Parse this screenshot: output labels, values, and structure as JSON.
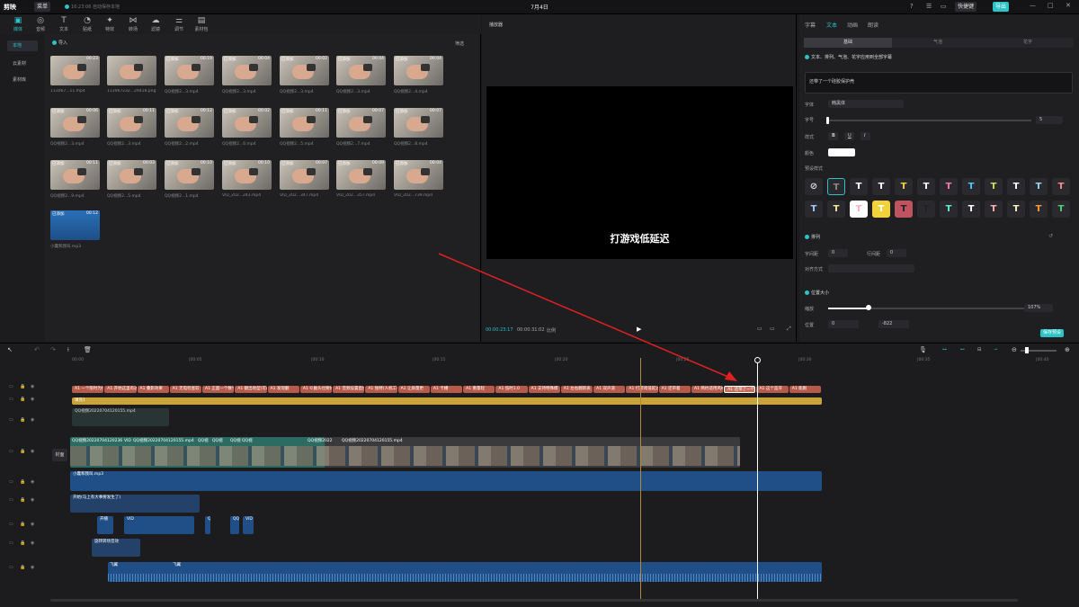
{
  "app": {
    "logo": "剪映",
    "menu": "菜单",
    "save_status": "16:23:06 自动保存本地",
    "title": "7月4日",
    "shortcut": "快捷键",
    "export": "导出"
  },
  "tools": [
    {
      "label": "媒体"
    },
    {
      "label": "音频"
    },
    {
      "label": "文本"
    },
    {
      "label": "贴纸"
    },
    {
      "label": "特效"
    },
    {
      "label": "转场"
    },
    {
      "label": "滤镜"
    },
    {
      "label": "调节"
    },
    {
      "label": "素材包"
    }
  ],
  "side": {
    "items": [
      "本地",
      "云素材",
      "素材库"
    ]
  },
  "media": {
    "import": "导入",
    "sort": "筛选",
    "items": [
      {
        "name": "113067...11.mp4",
        "dur": "00:23",
        "added": ""
      },
      {
        "name": "113067232...29418.png",
        "dur": "",
        "added": ""
      },
      {
        "name": "QQ视频2...3.mp4",
        "dur": "00:19",
        "added": "已添加"
      },
      {
        "name": "QQ视频2...3.mp4",
        "dur": "00:04",
        "added": "已添加"
      },
      {
        "name": "QQ视频2...3.mp4",
        "dur": "00:02",
        "added": "已添加"
      },
      {
        "name": "QQ视频2...3.mp4",
        "dur": "00:04",
        "added": "已添加"
      },
      {
        "name": "QQ视频2...4.mp4",
        "dur": "00:04",
        "added": "已添加"
      },
      {
        "name": "QQ视频2...3.mp4",
        "dur": "00:06",
        "added": "已添加"
      },
      {
        "name": "QQ视频2...3.mp4",
        "dur": "00:11",
        "added": "已添加"
      },
      {
        "name": "QQ视频2...2.mp4",
        "dur": "00:12",
        "added": "已添加"
      },
      {
        "name": "QQ视频2...6.mp4",
        "dur": "00:02",
        "added": "已添加"
      },
      {
        "name": "QQ视频2...5.mp4",
        "dur": "00:11",
        "added": "已添加"
      },
      {
        "name": "QQ视频2...7.mp4",
        "dur": "00:07",
        "added": "已添加"
      },
      {
        "name": "QQ视频2...8.mp4",
        "dur": "00:07",
        "added": "已添加"
      },
      {
        "name": "QQ视频2...9.mp4",
        "dur": "00:11",
        "added": "已添加"
      },
      {
        "name": "QQ视频2...5.mp4",
        "dur": "00:03",
        "added": "已添加"
      },
      {
        "name": "QQ视频2...1.mp4",
        "dur": "00:10",
        "added": "已添加"
      },
      {
        "name": "VID_202...243.mp4",
        "dur": "00:10",
        "added": "已添加"
      },
      {
        "name": "VID_202...347.mp4",
        "dur": "00:07",
        "added": "已添加"
      },
      {
        "name": "VID_202...357.mp4",
        "dur": "00:09",
        "added": "已添加"
      },
      {
        "name": "VID_202...739.mp4",
        "dur": "00:04",
        "added": "已添加"
      },
      {
        "name": "小蠢和我叫.mp3",
        "dur": "00:12",
        "added": "已添加"
      }
    ]
  },
  "player": {
    "title": "播放器",
    "caption": "打游戏低延迟",
    "time_current": "00:00:23:17",
    "time_total": "00:00:31:02",
    "ratio": "比例"
  },
  "props": {
    "tabs": [
      "字幕",
      "文本",
      "动画",
      "朗读"
    ],
    "segments": [
      "基础",
      "气泡",
      "花字"
    ],
    "apply_all": "文本、排列、气泡、花字应用到全部字幕",
    "text_value": "还带了一个硅胶保护壳",
    "font_label": "字体",
    "font_value": "韩黑体",
    "size_label": "字号",
    "size_value": "5",
    "style_label": "样式",
    "color_label": "颜色",
    "preset_label": "预设样式",
    "arrange_label": "排列",
    "char_spacing": "字间距",
    "char_spacing_val": "0",
    "line_spacing": "行间距",
    "line_spacing_val": "0",
    "align_label": "对齐方式",
    "pos_label": "位置大小",
    "scale_label": "缩放",
    "scale_value": "107%",
    "position_label": "位置",
    "x_val": "0",
    "y_val": "-822",
    "save_preset": "保存预设"
  },
  "timeline": {
    "ruler": [
      "00:00",
      "|00:05",
      "|00:10",
      "|00:15",
      "|00:20",
      "|00:25",
      "|00:30",
      "|00:35",
      "|00:40"
    ],
    "cover": "封面",
    "subs": [
      "A1 一个限时为什么会(给(",
      "A1 开始这里有透明",
      "A1 叠影效果",
      "A1 无电检查较",
      "A1 正面一个数字显示断可显示",
      "A1 翻出地型(可以)?",
      "A1 发现翻",
      "A1 ©触头也要好",
      "A1 音频设置直接",
      "A1 独特(人机工学)",
      "A1 让质量更",
      "A1 卡槽",
      "A1 重量轻",
      "A1 低时1.0",
      "A1 支持特殊模",
      "A1 左右翻新表",
      "A1 双声道",
      "A1 打游戏低延迟",
      "A1 还带着",
      "A1 简约适用风格",
      "A1 还带了一个硅胶",
      "A1 这个蓝牙",
      "A1 能跟"
    ],
    "text_track": "填充1",
    "video_top": "QQ视频20220704120155.mp4",
    "video_main": [
      "QQ视频20220704120236",
      "VID",
      "QQ视频20220704120155.mp4",
      "QQ视",
      "QQ视",
      "QQ视",
      "QQ视",
      "QQ视频2022",
      "QQ视频20220704120155.mp4"
    ],
    "audio1": "小蠢和我叫.mp3",
    "audio2": "开始(马上有大事要发生了)",
    "audio3": [
      "开播",
      "VID",
      "QQ视频20220704120155",
      "QQ",
      "VID"
    ],
    "audio4": "旋转转场音效",
    "audio5": [
      "飞翼",
      "飞翼"
    ]
  }
}
